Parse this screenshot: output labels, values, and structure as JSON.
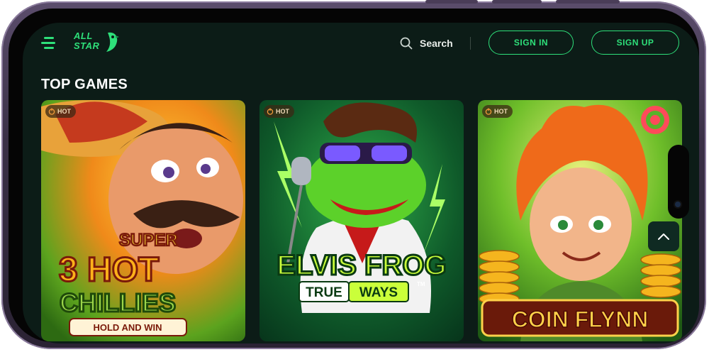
{
  "header": {
    "logo_text_line1": "ALL",
    "logo_text_line2": "STAR",
    "search_label": "Search",
    "sign_in_label": "SIGN IN",
    "sign_up_label": "SIGN UP"
  },
  "section": {
    "title": "TOP GAMES"
  },
  "games": [
    {
      "badge": "HOT",
      "title_line1": "SUPER",
      "title_line2": "3 HOT",
      "title_line3": "CHILLIES",
      "subtitle": "HOLD AND WIN"
    },
    {
      "badge": "HOT",
      "title_line1": "ELVIS FROG",
      "subtitle_a": "TRUE",
      "subtitle_b": "WAYS",
      "tm": "TM"
    },
    {
      "badge": "HOT",
      "title_line1": "COIN FLYNN"
    }
  ],
  "icons": {
    "menu": "hamburger-menu-icon",
    "search": "search-icon",
    "hot": "fire-icon",
    "scroll_top": "chevron-up-icon"
  },
  "colors": {
    "accent": "#2ee07a",
    "background": "#0c1c17",
    "phone_frame": "#3a3046"
  }
}
